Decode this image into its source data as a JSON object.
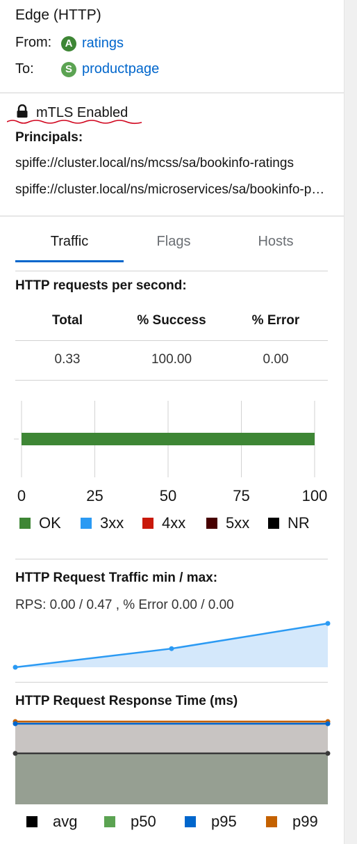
{
  "edge": {
    "title": "Edge (HTTP)",
    "from_label": "From:",
    "to_label": "To:",
    "from": {
      "badge": "A",
      "badge_color": "#3e8635",
      "name": "ratings"
    },
    "to": {
      "badge": "S",
      "badge_color": "#5ba352",
      "name": "productpage"
    }
  },
  "security": {
    "mtls": "mTLS Enabled",
    "principals_label": "Principals:",
    "principals": [
      "spiffe://cluster.local/ns/mcss/sa/bookinfo-ratings",
      "spiffe://cluster.local/ns/microservices/sa/bookinfo-productpage"
    ]
  },
  "tabs": [
    {
      "label": "Traffic",
      "active": true
    },
    {
      "label": "Flags",
      "active": false
    },
    {
      "label": "Hosts",
      "active": false
    }
  ],
  "http_rps": {
    "title": "HTTP requests per second:",
    "headers": [
      "Total",
      "% Success",
      "% Error"
    ],
    "values": [
      "0.33",
      "100.00",
      "0.00"
    ]
  },
  "chart_data": [
    {
      "type": "bar",
      "orientation": "horizontal",
      "stacked": true,
      "categories": [
        ""
      ],
      "series": [
        {
          "name": "OK",
          "color": "#3e8635",
          "values": [
            100
          ]
        },
        {
          "name": "3xx",
          "color": "#2b9af3",
          "values": [
            0
          ]
        },
        {
          "name": "4xx",
          "color": "#c9190b",
          "values": [
            0
          ]
        },
        {
          "name": "5xx",
          "color": "#470000",
          "values": [
            0
          ]
        },
        {
          "name": "NR",
          "color": "#000000",
          "values": [
            0
          ]
        }
      ],
      "x_ticks": [
        0,
        25,
        50,
        75,
        100
      ],
      "xlim": [
        0,
        100
      ],
      "grid": true,
      "legend": "bottom"
    },
    {
      "type": "area",
      "title": "HTTP Request Traffic min / max:",
      "subtitle": "RPS: 0.00 / 0.47 , % Error 0.00 / 0.00",
      "series": [
        {
          "name": "RPS",
          "color": "#2b9af3",
          "fill": "#d4e8fb",
          "x": [
            0,
            1,
            2
          ],
          "values": [
            0.0,
            0.2,
            0.47
          ]
        }
      ],
      "ylim": [
        0,
        0.47
      ]
    },
    {
      "type": "area",
      "title": "HTTP Request Response Time (ms)",
      "x": [
        0,
        1
      ],
      "series": [
        {
          "name": "avg",
          "color": "#000000",
          "values": [
            0.0,
            0.0
          ]
        },
        {
          "name": "p50",
          "color": "#5ba352",
          "values": [
            24.0,
            24.0
          ]
        },
        {
          "name": "p95",
          "color": "#0066cc",
          "values": [
            38.0,
            38.0
          ]
        },
        {
          "name": "p99",
          "color": "#c46100",
          "values": [
            39.0,
            39.0
          ]
        }
      ],
      "ylim": [
        0,
        40
      ],
      "legend": "bottom"
    }
  ]
}
